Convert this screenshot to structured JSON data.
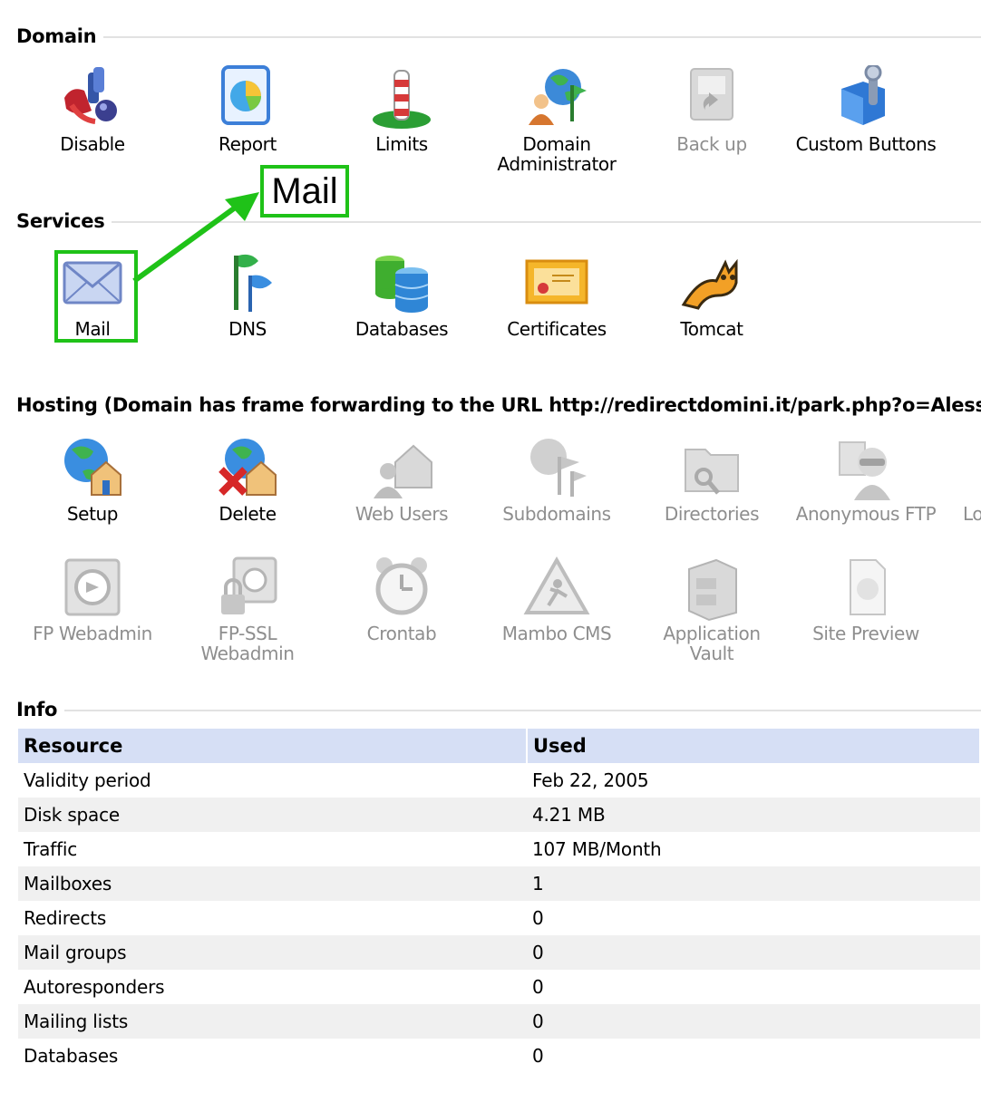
{
  "colors": {
    "highlight": "#1fc218",
    "header_bg": "#d6dff5",
    "disabled_text": "#8e8e8e"
  },
  "domain": {
    "title": "Domain",
    "items": [
      {
        "label": "Disable",
        "icon": "disable-icon"
      },
      {
        "label": "Report",
        "icon": "report-icon"
      },
      {
        "label": "Limits",
        "icon": "limits-icon"
      },
      {
        "label": "Domain Administrator",
        "label_line1": "Domain",
        "label_line2": "Administrator",
        "icon": "domain-administrator-icon"
      },
      {
        "label": "Back up",
        "icon": "backup-icon",
        "disabled": true
      },
      {
        "label": "Custom Buttons",
        "icon": "custom-buttons-icon"
      }
    ]
  },
  "callout": {
    "text": "Mail"
  },
  "services": {
    "title": "Services",
    "items": [
      {
        "label": "Mail",
        "icon": "mail-icon"
      },
      {
        "label": "DNS",
        "icon": "dns-icon"
      },
      {
        "label": "Databases",
        "icon": "databases-icon"
      },
      {
        "label": "Certificates",
        "icon": "certificates-icon"
      },
      {
        "label": "Tomcat",
        "icon": "tomcat-icon"
      }
    ]
  },
  "hosting": {
    "title": "Hosting (Domain has frame forwarding to the URL http://redirectdomini.it/park.php?o=Alessa",
    "row1": [
      {
        "label": "Setup",
        "icon": "setup-icon"
      },
      {
        "label": "Delete",
        "icon": "delete-icon"
      },
      {
        "label": "Web Users",
        "icon": "web-users-icon",
        "disabled": true
      },
      {
        "label": "Subdomains",
        "icon": "subdomains-icon",
        "disabled": true
      },
      {
        "label": "Directories",
        "icon": "directories-icon",
        "disabled": true
      },
      {
        "label": "Anonymous FTP",
        "icon": "anonymous-ftp-icon",
        "disabled": true
      },
      {
        "label": "Lo",
        "icon": "",
        "disabled": true
      }
    ],
    "row2": [
      {
        "label": "FP Webadmin",
        "icon": "fp-webadmin-icon",
        "disabled": true
      },
      {
        "label": "FP-SSL Webadmin",
        "label_line1": "FP-SSL",
        "label_line2": "Webadmin",
        "icon": "fp-ssl-webadmin-icon",
        "disabled": true
      },
      {
        "label": "Crontab",
        "icon": "crontab-icon",
        "disabled": true
      },
      {
        "label": "Mambo CMS",
        "icon": "mambo-cms-icon",
        "disabled": true
      },
      {
        "label": "Application Vault",
        "icon": "application-vault-icon",
        "disabled": true
      },
      {
        "label": "Site Preview",
        "icon": "site-preview-icon",
        "disabled": true
      }
    ]
  },
  "info": {
    "title": "Info",
    "headers": [
      "Resource",
      "Used"
    ],
    "rows": [
      [
        "Validity period",
        "Feb 22, 2005"
      ],
      [
        "Disk space",
        "4.21 MB"
      ],
      [
        "Traffic",
        "107 MB/Month"
      ],
      [
        "Mailboxes",
        "1"
      ],
      [
        "Redirects",
        "0"
      ],
      [
        "Mail groups",
        "0"
      ],
      [
        "Autoresponders",
        "0"
      ],
      [
        "Mailing lists",
        "0"
      ],
      [
        "Databases",
        "0"
      ]
    ]
  }
}
